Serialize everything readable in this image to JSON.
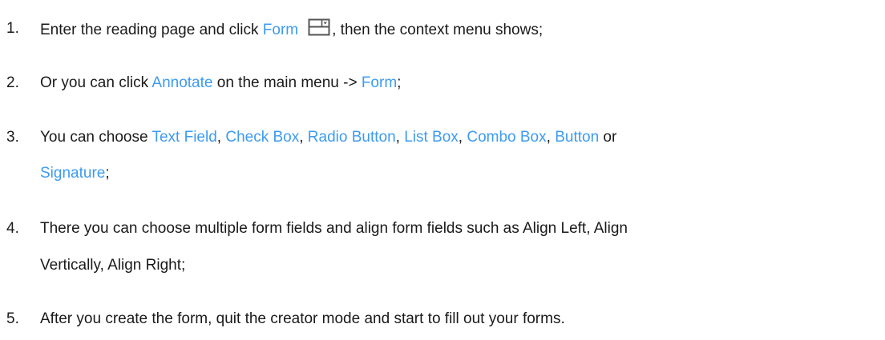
{
  "steps": [
    {
      "number": "1.",
      "t1": "Enter the reading page and click ",
      "link": "Form",
      "icon": "form-icon",
      "t2": ", then the context menu shows;"
    },
    {
      "number": "2.",
      "t1": "Or you can click ",
      "link1": "Annotate",
      "t2": " on the main menu -> ",
      "link2": "Form",
      "t3": ";"
    },
    {
      "number": "3.",
      "t1": "You can choose ",
      "items": [
        "Text Field",
        "Check Box",
        "Radio Button",
        "List Box",
        "Combo Box",
        "Button"
      ],
      "sep": ", ",
      "t_or": " or",
      "last": "Signature",
      "t_end": ";"
    },
    {
      "number": "4.",
      "line1": "There you can choose multiple form fields and align form fields such as Align Left, Align",
      "line2": "Vertically, Align Right;"
    },
    {
      "number": "5.",
      "text": "After you create the form, quit the creator mode and start to fill out your forms."
    }
  ],
  "colors": {
    "link": "#3d9bf0",
    "text": "#1a1a1a"
  }
}
